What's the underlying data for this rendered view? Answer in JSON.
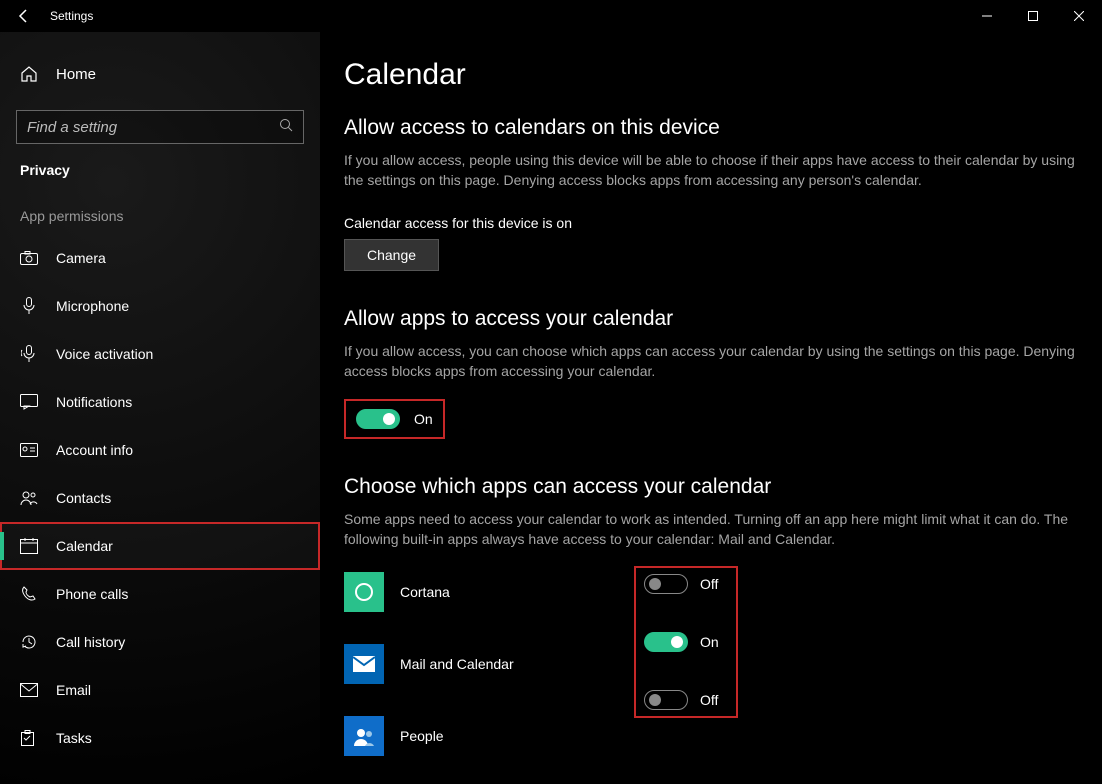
{
  "titlebar": {
    "title": "Settings"
  },
  "sidebar": {
    "home": "Home",
    "search_placeholder": "Find a setting",
    "section": "Privacy",
    "subsection": "App permissions",
    "items": [
      {
        "label": "Camera",
        "icon": "camera-icon"
      },
      {
        "label": "Microphone",
        "icon": "microphone-icon"
      },
      {
        "label": "Voice activation",
        "icon": "voice-icon"
      },
      {
        "label": "Notifications",
        "icon": "notifications-icon"
      },
      {
        "label": "Account info",
        "icon": "account-icon"
      },
      {
        "label": "Contacts",
        "icon": "contacts-icon"
      },
      {
        "label": "Calendar",
        "icon": "calendar-icon",
        "active": true,
        "highlight": true
      },
      {
        "label": "Phone calls",
        "icon": "phone-icon"
      },
      {
        "label": "Call history",
        "icon": "history-icon"
      },
      {
        "label": "Email",
        "icon": "email-icon"
      },
      {
        "label": "Tasks",
        "icon": "tasks-icon"
      }
    ]
  },
  "main": {
    "title": "Calendar",
    "section1": {
      "heading": "Allow access to calendars on this device",
      "desc": "If you allow access, people using this device will be able to choose if their apps have access to their calendar by using the settings on this page. Denying access blocks apps from accessing any person's calendar.",
      "status": "Calendar access for this device is on",
      "button": "Change"
    },
    "section2": {
      "heading": "Allow apps to access your calendar",
      "desc": "If you allow access, you can choose which apps can access your calendar by using the settings on this page. Denying access blocks apps from accessing your calendar.",
      "toggle_state": "On",
      "toggle_on": true
    },
    "section3": {
      "heading": "Choose which apps can access your calendar",
      "desc": "Some apps need to access your calendar to work as intended. Turning off an app here might limit what it can do. The following built-in apps always have access to your calendar: Mail and Calendar.",
      "apps": [
        {
          "name": "Cortana",
          "state": "Off",
          "on": false
        },
        {
          "name": "Mail and Calendar",
          "state": "On",
          "on": true
        },
        {
          "name": "People",
          "state": "Off",
          "on": false
        }
      ]
    }
  }
}
